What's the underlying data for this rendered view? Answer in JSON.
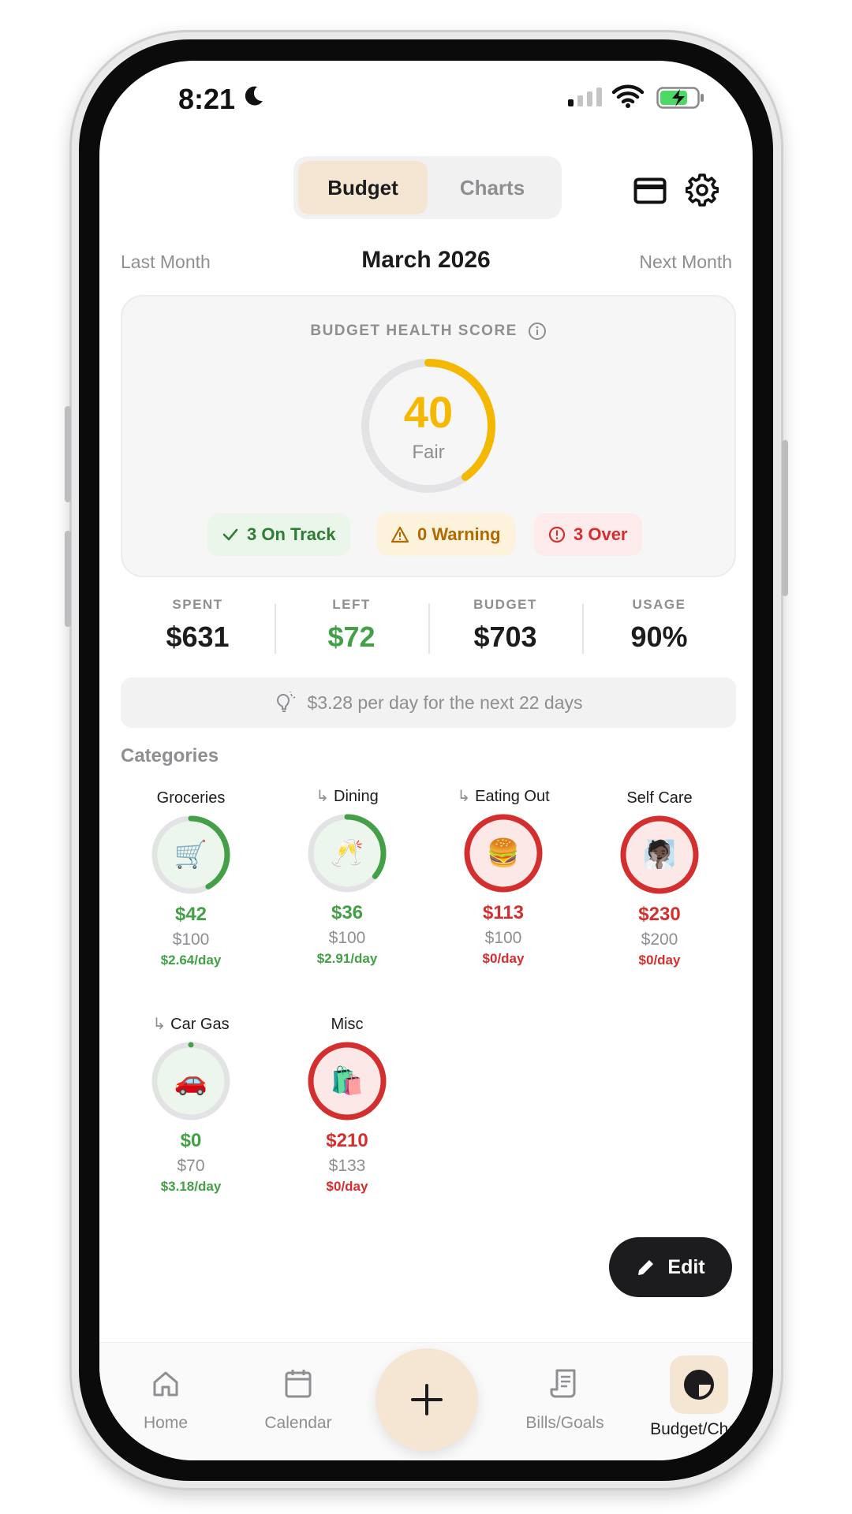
{
  "status_bar": {
    "time": "8:21"
  },
  "tabs": [
    {
      "label": "Budget",
      "active": true
    },
    {
      "label": "Charts",
      "active": false
    }
  ],
  "month_nav": {
    "prev": "Last Month",
    "title": "March 2026",
    "next": "Next Month"
  },
  "health": {
    "label": "BUDGET HEALTH SCORE",
    "score": "40",
    "rating": "Fair",
    "score_fraction": 0.4,
    "on_track": "3 On Track",
    "warning": "0 Warning",
    "over": "3 Over"
  },
  "stats": [
    {
      "label": "SPENT",
      "value": "$631"
    },
    {
      "label": "LEFT",
      "value": "$72"
    },
    {
      "label": "BUDGET",
      "value": "$703"
    },
    {
      "label": "USAGE",
      "value": "90%"
    }
  ],
  "tip": "$3.28 per day for the next 22 days",
  "categories_heading": "Categories",
  "categories": [
    {
      "name": "Groceries",
      "sub": false,
      "emoji": "🛒",
      "spent": "$42",
      "budget": "$100",
      "per_day": "$2.64/day",
      "status": "ok",
      "fraction": 0.42
    },
    {
      "name": "Dining",
      "sub": true,
      "emoji": "🥂",
      "spent": "$36",
      "budget": "$100",
      "per_day": "$2.91/day",
      "status": "ok",
      "fraction": 0.36
    },
    {
      "name": "Eating Out",
      "sub": true,
      "emoji": "🍔",
      "spent": "$113",
      "budget": "$100",
      "per_day": "$0/day",
      "status": "over",
      "fraction": 1
    },
    {
      "name": "Self Care",
      "sub": false,
      "emoji": "🧖🏿",
      "spent": "$230",
      "budget": "$200",
      "per_day": "$0/day",
      "status": "over",
      "fraction": 1
    },
    {
      "name": "Car Gas",
      "sub": true,
      "emoji": "🚗",
      "spent": "$0",
      "budget": "$70",
      "per_day": "$3.18/day",
      "status": "ok",
      "fraction": 0
    },
    {
      "name": "Misc",
      "sub": false,
      "emoji": "🛍️",
      "spent": "$210",
      "budget": "$133",
      "per_day": "$0/day",
      "status": "over",
      "fraction": 1
    }
  ],
  "sub_marker": "↳",
  "edit_label": "Edit",
  "nav": [
    {
      "label": "Home",
      "icon": "home-icon"
    },
    {
      "label": "Calendar",
      "icon": "calendar-icon"
    },
    {
      "label": "Bills/Goals",
      "icon": "receipt-icon"
    },
    {
      "label": "Budget/Chart",
      "icon": "pie-chart-icon",
      "active": true
    }
  ],
  "colors": {
    "accent": "#f5e6d3",
    "green": "#43a047",
    "red": "#d32f2f",
    "score": "#f5b800"
  }
}
